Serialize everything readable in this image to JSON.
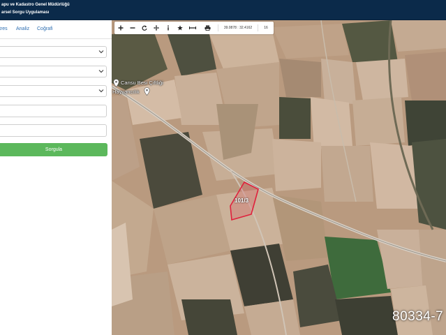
{
  "header": {
    "title_line1": "apu ve Kadastro Genel Müdürlüğü",
    "title_line2": "arsel Sorgu Uygulaması"
  },
  "sidebar": {
    "tabs": [
      {
        "label": "tres"
      },
      {
        "label": "Analiz"
      },
      {
        "label": "Coğrafi"
      }
    ],
    "selects": [
      {
        "value": ""
      },
      {
        "value": ""
      },
      {
        "value": ""
      }
    ],
    "inputs": [
      {
        "value": "",
        "placeholder": ""
      },
      {
        "value": "",
        "placeholder": ""
      }
    ],
    "query_button_label": "Sorgula"
  },
  "map": {
    "toolbar": {
      "icons": [
        "zoom-in-icon",
        "zoom-out-icon",
        "refresh-icon",
        "pan-icon",
        "info-icon",
        "star-icon",
        "measure-icon",
        "print-icon"
      ],
      "coordinates": "39.0878 : 32.4162",
      "zoom_level": "16"
    },
    "poi": {
      "name_line1": "Cansu Besi Çiftliği",
      "name_line2": "Hayvancılık"
    },
    "parcel_label": "101/3",
    "parcel_outline_color": "#e0203c",
    "watermark": "80334-7"
  }
}
